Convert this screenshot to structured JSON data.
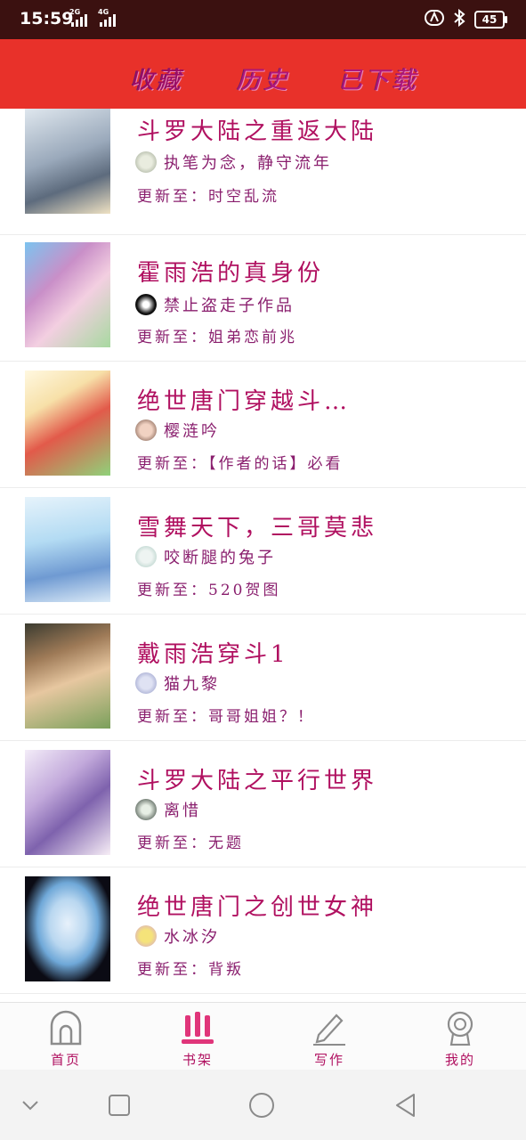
{
  "status_bar": {
    "time": "15:59",
    "signal1_label": "2G",
    "signal2_label": "4G",
    "battery": "45",
    "icons": [
      "nfc-icon",
      "bluetooth-icon",
      "battery-icon"
    ]
  },
  "top_tabs": [
    {
      "label": "收藏",
      "active": true
    },
    {
      "label": "历史",
      "active": false
    },
    {
      "label": "已下载",
      "active": false
    }
  ],
  "update_prefix": "更新至：",
  "books": [
    {
      "title": "斗罗大陆之重返大陆",
      "author": "执笔为念，静守流年",
      "update": "时空乱流",
      "cover_colors": [
        "#d7dfe8",
        "#7f8fa3",
        "#f2e6c8"
      ]
    },
    {
      "title": "霍雨浩的真身份",
      "author": "禁止盗走子作品",
      "update": "姐弟恋前兆",
      "cover_colors": [
        "#6fb6e9",
        "#c96fa7",
        "#f7d8e6"
      ]
    },
    {
      "title": "绝世唐门穿越斗…",
      "author": "樱涟吟",
      "update": "【作者的话】必看",
      "cover_colors": [
        "#fef3d6",
        "#d94a4a",
        "#7ccf6b"
      ]
    },
    {
      "title": "雪舞天下，三哥莫悲",
      "author": "咬断腿的兔子",
      "update": "520贺图",
      "cover_colors": [
        "#b9dff5",
        "#5e8fcf",
        "#e8f4fb"
      ]
    },
    {
      "title": "戴雨浩穿斗1",
      "author": "猫九黎",
      "update": "哥哥姐姐？！",
      "cover_colors": [
        "#8d6b4f",
        "#e9c9a1",
        "#2f3a2f"
      ]
    },
    {
      "title": "斗罗大陆之平行世界",
      "author": "离惜",
      "update": "无题",
      "cover_colors": [
        "#e6d6ef",
        "#8b6fb2",
        "#f5eef8"
      ]
    },
    {
      "title": "绝世唐门之创世女神",
      "author": "水冰汐",
      "update": "背叛",
      "cover_colors": [
        "#0c0c14",
        "#cfe3f5",
        "#7fb4e0"
      ]
    },
    {
      "title": "",
      "author": "",
      "update": "",
      "cover_colors": [
        "#f6e9b8",
        "#d8c47a",
        "#fff7d9"
      ]
    }
  ],
  "bottom_nav": [
    {
      "label": "首页",
      "icon": "home-icon",
      "active": false
    },
    {
      "label": "书架",
      "icon": "bookshelf-icon",
      "active": true
    },
    {
      "label": "写作",
      "icon": "pencil-icon",
      "active": false
    },
    {
      "label": "我的",
      "icon": "profile-icon",
      "active": false
    }
  ],
  "system_nav": [
    "chevron-down-icon",
    "recent-apps-icon",
    "home-circle-icon",
    "back-icon"
  ],
  "colors": {
    "status_bar": "#3b1110",
    "top_bar": "#e8312a",
    "accent_text": "#b01060",
    "active_nav": "#e0357a"
  }
}
